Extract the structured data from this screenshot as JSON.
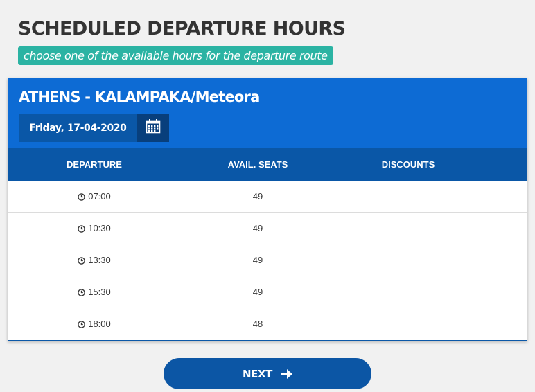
{
  "page": {
    "title": "SCHEDULED DEPARTURE HOURS",
    "subtitle": "choose one of the available hours for the departure route"
  },
  "route": {
    "name": "ATHENS - KALAMPAKA/Meteora",
    "date": "Friday, 17-04-2020",
    "calendar_icon": "calendar-icon"
  },
  "table": {
    "headers": [
      "DEPARTURE",
      "AVAIL. SEATS",
      "DISCOUNTS"
    ],
    "rows": [
      {
        "departure": "07:00",
        "seats": "49",
        "discounts": ""
      },
      {
        "departure": "10:30",
        "seats": "49",
        "discounts": ""
      },
      {
        "departure": "13:30",
        "seats": "49",
        "discounts": ""
      },
      {
        "departure": "15:30",
        "seats": "49",
        "discounts": ""
      },
      {
        "departure": "18:00",
        "seats": "48",
        "discounts": ""
      }
    ]
  },
  "actions": {
    "next_label": "NEXT",
    "next_icon": "arrow-right-icon"
  },
  "colors": {
    "background": "#f1f1f1",
    "accent_teal": "#2bb3a3",
    "header_blue": "#0d6bd4",
    "dark_blue": "#0a57a7",
    "darker_blue": "#083f7c"
  }
}
